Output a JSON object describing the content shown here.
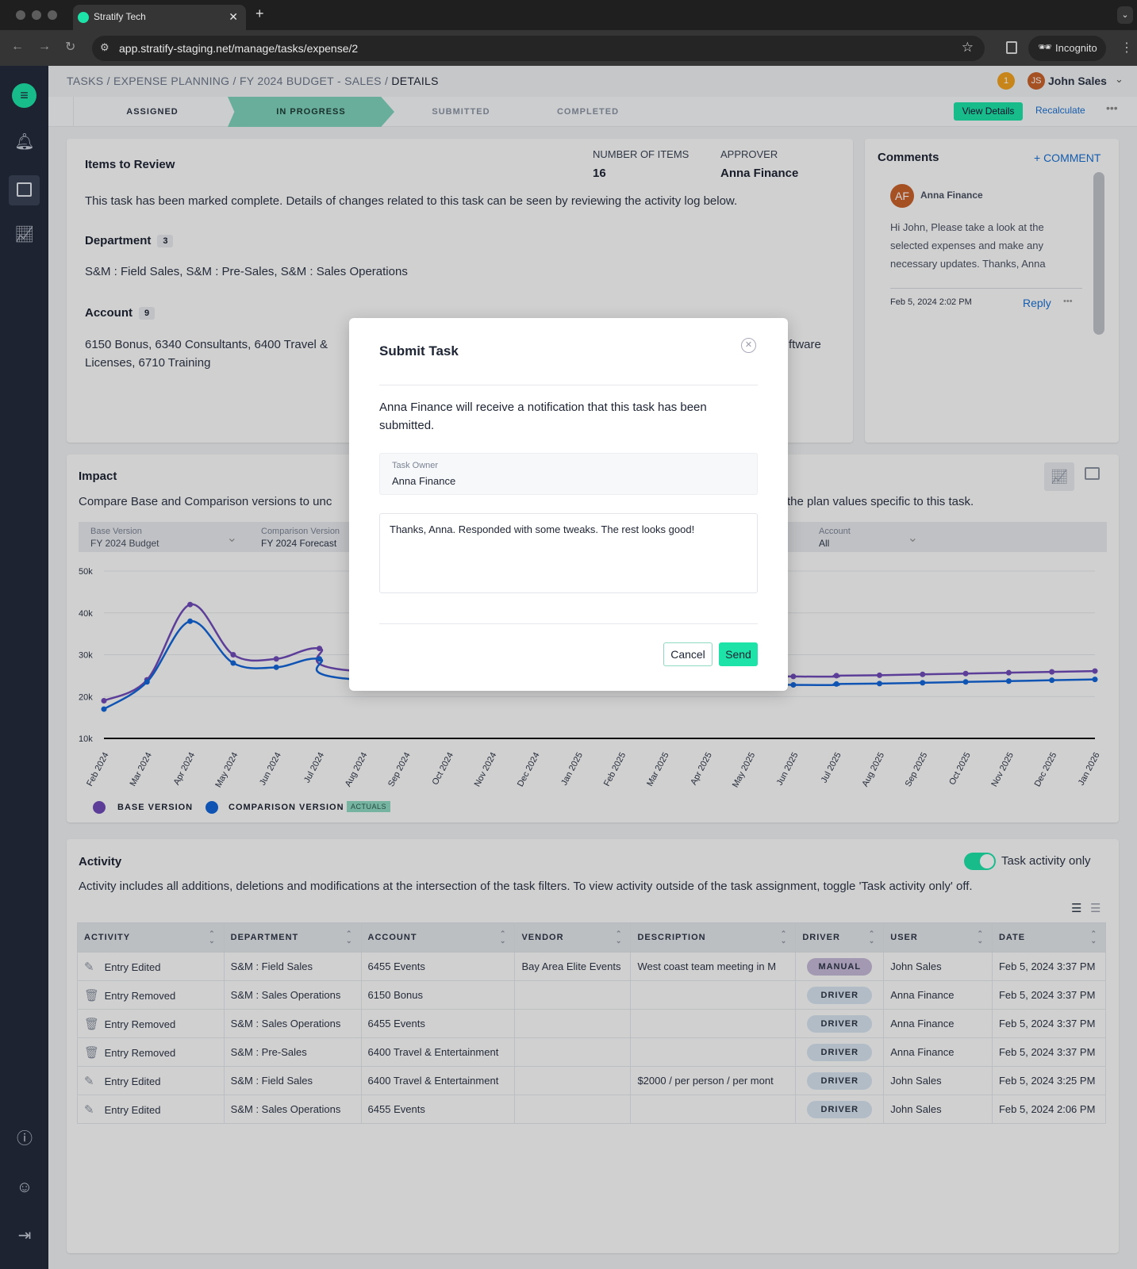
{
  "browser": {
    "tab_title": "Stratify Tech",
    "url": "app.stratify-staging.net/manage/tasks/expense/2",
    "incognito": "Incognito"
  },
  "header": {
    "breadcrumb": [
      "TASKS",
      "EXPENSE PLANNING",
      "FY 2024 BUDGET - SALES"
    ],
    "breadcrumb_current": "DETAILS",
    "notification_count": "1",
    "user_initials": "JS",
    "user_name": "John Sales"
  },
  "stepper": {
    "steps": [
      "ASSIGNED",
      "IN PROGRESS",
      "SUBMITTED",
      "COMPLETED"
    ],
    "active": "IN PROGRESS",
    "view_details": "View Details",
    "recalculate": "Recalculate"
  },
  "items": {
    "title": "Items to Review",
    "num_items_label": "NUMBER OF ITEMS",
    "num_items": "16",
    "approver_label": "APPROVER",
    "approver": "Anna Finance",
    "message": "This task has been marked complete. Details of changes related to this task can be seen by reviewing the activity log below.",
    "department_label": "Department",
    "department_count": "3",
    "departments": "S&M : Field Sales, S&M : Pre-Sales, S&M : Sales Operations",
    "account_label": "Account",
    "account_count": "9",
    "accounts_part1": "6150 Bonus, 6340 Consultants, 6400 Travel &",
    "accounts_part2": "ftware",
    "accounts_line2": "Licenses, 6710 Training"
  },
  "comments": {
    "title": "Comments",
    "add": "+ COMMENT",
    "author_initials": "AF",
    "author": "Anna Finance",
    "body": "Hi John, Please take a look at the selected expenses and make any necessary updates. Thanks, Anna",
    "date": "Feb 5, 2024 2:02 PM",
    "reply": "Reply"
  },
  "impact": {
    "title": "Impact",
    "desc_left": "Compare Base and Comparison versions to unc",
    "desc_right": "the plan values specific to this task.",
    "filters": [
      {
        "label": "Base Version",
        "value": "FY 2024 Budget"
      },
      {
        "label": "Comparison Version",
        "value": "FY 2024 Forecast"
      },
      {
        "label": "Account",
        "value": "All"
      }
    ],
    "legend": {
      "base": "BASE VERSION",
      "comparison": "COMPARISON VERSION",
      "actuals": "ACTUALS"
    }
  },
  "chart_data": {
    "type": "line",
    "ylim": [
      10000,
      50000
    ],
    "yticks": [
      "50k",
      "40k",
      "30k",
      "20k",
      "10k"
    ],
    "ytick_values": [
      50000,
      40000,
      30000,
      20000,
      10000
    ],
    "categories": [
      "Feb 2024",
      "Mar 2024",
      "Apr 2024",
      "May 2024",
      "Jun 2024",
      "Jul 2024",
      "Aug 2024",
      "Sep 2024",
      "Oct 2024",
      "Nov 2024",
      "Dec 2024",
      "Jan 2025",
      "Feb 2025",
      "Mar 2025",
      "Apr 2025",
      "May 2025",
      "Jun 2025",
      "Jul 2025",
      "Aug 2025",
      "Sep 2025",
      "Oct 2025",
      "Nov 2025",
      "Dec 2025",
      "Jan 2026"
    ],
    "series": [
      {
        "name": "BASE VERSION",
        "color": "#6f4bb8",
        "values": [
          19000,
          24000,
          42000,
          30000,
          29000,
          31500,
          26000,
          null,
          null,
          null,
          null,
          null,
          null,
          null,
          null,
          null,
          24800,
          25000,
          25100,
          25300,
          25500,
          25700,
          25900,
          26100
        ]
      },
      {
        "name": "COMPARISON VERSION",
        "color": "#1466d8",
        "values": [
          17000,
          23500,
          38000,
          28000,
          27000,
          29000,
          24000,
          null,
          null,
          null,
          null,
          null,
          null,
          null,
          null,
          null,
          22800,
          23000,
          23100,
          23300,
          23500,
          23700,
          23900,
          24100
        ]
      }
    ],
    "grid": true,
    "legend": "bottom-left"
  },
  "activity": {
    "title": "Activity",
    "toggle_label": "Task activity only",
    "toggle_on": true,
    "desc": "Activity includes all additions, deletions and modifications at the intersection of the task filters. To view activity outside of the task assignment, toggle 'Task activity only' off.",
    "columns": [
      "ACTIVITY",
      "DEPARTMENT",
      "ACCOUNT",
      "VENDOR",
      "DESCRIPTION",
      "DRIVER",
      "USER",
      "DATE"
    ],
    "rows": [
      {
        "icon": "pencil-icon",
        "activity": "Entry Edited",
        "department": "S&M : Field Sales",
        "account": "6455 Events",
        "vendor": "Bay Area Elite Events",
        "description": "West coast team meeting in M",
        "driver": "MANUAL",
        "user": "John Sales",
        "date": "Feb 5, 2024 3:37 PM"
      },
      {
        "icon": "trash-icon",
        "activity": "Entry Removed",
        "department": "S&M : Sales Operations",
        "account": "6150 Bonus",
        "vendor": "",
        "description": "",
        "driver": "DRIVER",
        "user": "Anna Finance",
        "date": "Feb 5, 2024 3:37 PM"
      },
      {
        "icon": "trash-icon",
        "activity": "Entry Removed",
        "department": "S&M : Sales Operations",
        "account": "6455 Events",
        "vendor": "",
        "description": "",
        "driver": "DRIVER",
        "user": "Anna Finance",
        "date": "Feb 5, 2024 3:37 PM"
      },
      {
        "icon": "trash-icon",
        "activity": "Entry Removed",
        "department": "S&M : Pre-Sales",
        "account": "6400 Travel & Entertainment",
        "vendor": "",
        "description": "",
        "driver": "DRIVER",
        "user": "Anna Finance",
        "date": "Feb 5, 2024 3:37 PM"
      },
      {
        "icon": "pencil-icon",
        "activity": "Entry Edited",
        "department": "S&M : Field Sales",
        "account": "6400 Travel & Entertainment",
        "vendor": "",
        "description": "$2000 / per person / per mont",
        "driver": "DRIVER",
        "user": "John Sales",
        "date": "Feb 5, 2024 3:25 PM"
      },
      {
        "icon": "pencil-icon",
        "activity": "Entry Edited",
        "department": "S&M : Sales Operations",
        "account": "6455 Events",
        "vendor": "",
        "description": "",
        "driver": "DRIVER",
        "user": "John Sales",
        "date": "Feb 5, 2024 2:06 PM"
      }
    ]
  },
  "modal": {
    "title": "Submit Task",
    "message": "Anna Finance will receive a notification that this task has been submitted.",
    "owner_label": "Task Owner",
    "owner": "Anna Finance",
    "comment": "Thanks, Anna. Responded with some tweaks. The rest looks good!",
    "cancel": "Cancel",
    "send": "Send"
  },
  "colors": {
    "accent": "#1ee3a8",
    "step_active": "#7fd1bb",
    "link": "#1a6fd0",
    "sidebar": "#232b3b",
    "avatar": "#c8622c"
  }
}
